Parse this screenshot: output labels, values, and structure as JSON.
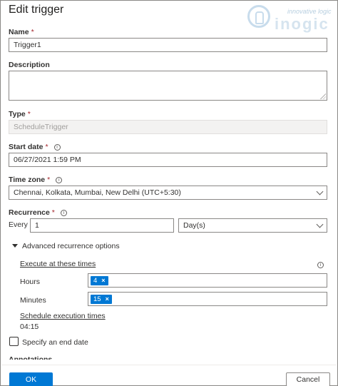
{
  "dialog": {
    "title": "Edit trigger",
    "logo": {
      "tagline": "innovative logic",
      "brand": "inogic"
    }
  },
  "fields": {
    "name": {
      "label": "Name",
      "required": "*",
      "value": "Trigger1"
    },
    "description": {
      "label": "Description",
      "value": ""
    },
    "type": {
      "label": "Type",
      "required": "*",
      "value": "ScheduleTrigger"
    },
    "start_date": {
      "label": "Start date",
      "required": "*",
      "value": "06/27/2021 1:59 PM"
    },
    "time_zone": {
      "label": "Time zone",
      "required": "*",
      "value": "Chennai, Kolkata, Mumbai, New Delhi (UTC+5:30)"
    },
    "recurrence": {
      "label": "Recurrence",
      "required": "*",
      "every_label": "Every",
      "interval": "1",
      "unit": "Day(s)"
    }
  },
  "advanced": {
    "toggle_label": "Advanced recurrence options",
    "execute_label": "Execute at these times",
    "hours_label": "Hours",
    "hours_chip": "4",
    "minutes_label": "Minutes",
    "minutes_chip": "15",
    "schedule_label": "Schedule execution times",
    "schedule_value": "04:15"
  },
  "end_date": {
    "label": "Specify an end date",
    "checked": false
  },
  "annotations": {
    "label": "Annotations"
  },
  "buttons": {
    "ok": "OK",
    "cancel": "Cancel"
  },
  "icons": {
    "info": "info-icon",
    "remove": "×",
    "chevron": "chevron-down-icon"
  },
  "colors": {
    "primary": "#0078d4",
    "required": "#a4262c"
  }
}
